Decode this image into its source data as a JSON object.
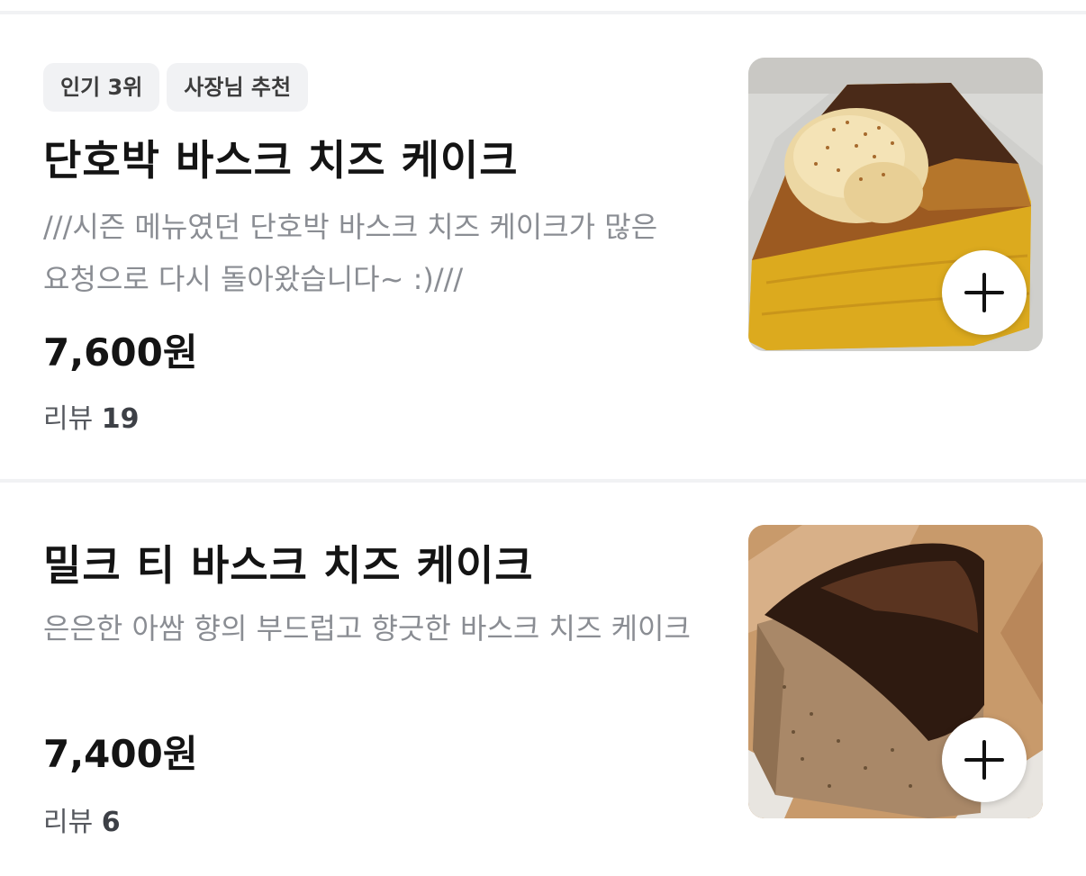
{
  "menu_items": [
    {
      "badges": [
        "인기 3위",
        "사장님 추천"
      ],
      "title": "단호박 바스크 치즈 케이크",
      "description": "///시즌 메뉴였던 단호박 바스크 치즈 케이크가 많은 요청으로 다시 돌아왔습니다~ :)///",
      "price": "7,600원",
      "review_label": "리뷰",
      "review_count": "19",
      "photo_icon": "pumpkin-cheesecake-photo",
      "add_icon": "plus-icon"
    },
    {
      "badges": [],
      "title": "밀크 티 바스크 치즈 케이크",
      "description": "은은한 아쌈 향의 부드럽고 향긋한 바스크 치즈 케이크",
      "price": "7,400원",
      "review_label": "리뷰",
      "review_count": "6",
      "photo_icon": "milk-tea-cheesecake-photo",
      "add_icon": "plus-icon"
    }
  ],
  "colors": {
    "badge_bg": "#f1f2f4",
    "description": "#8a8d93",
    "divider": "#f1f2f4",
    "pumpkin": "#e5b62a",
    "burnt_top": "#3a2418"
  }
}
